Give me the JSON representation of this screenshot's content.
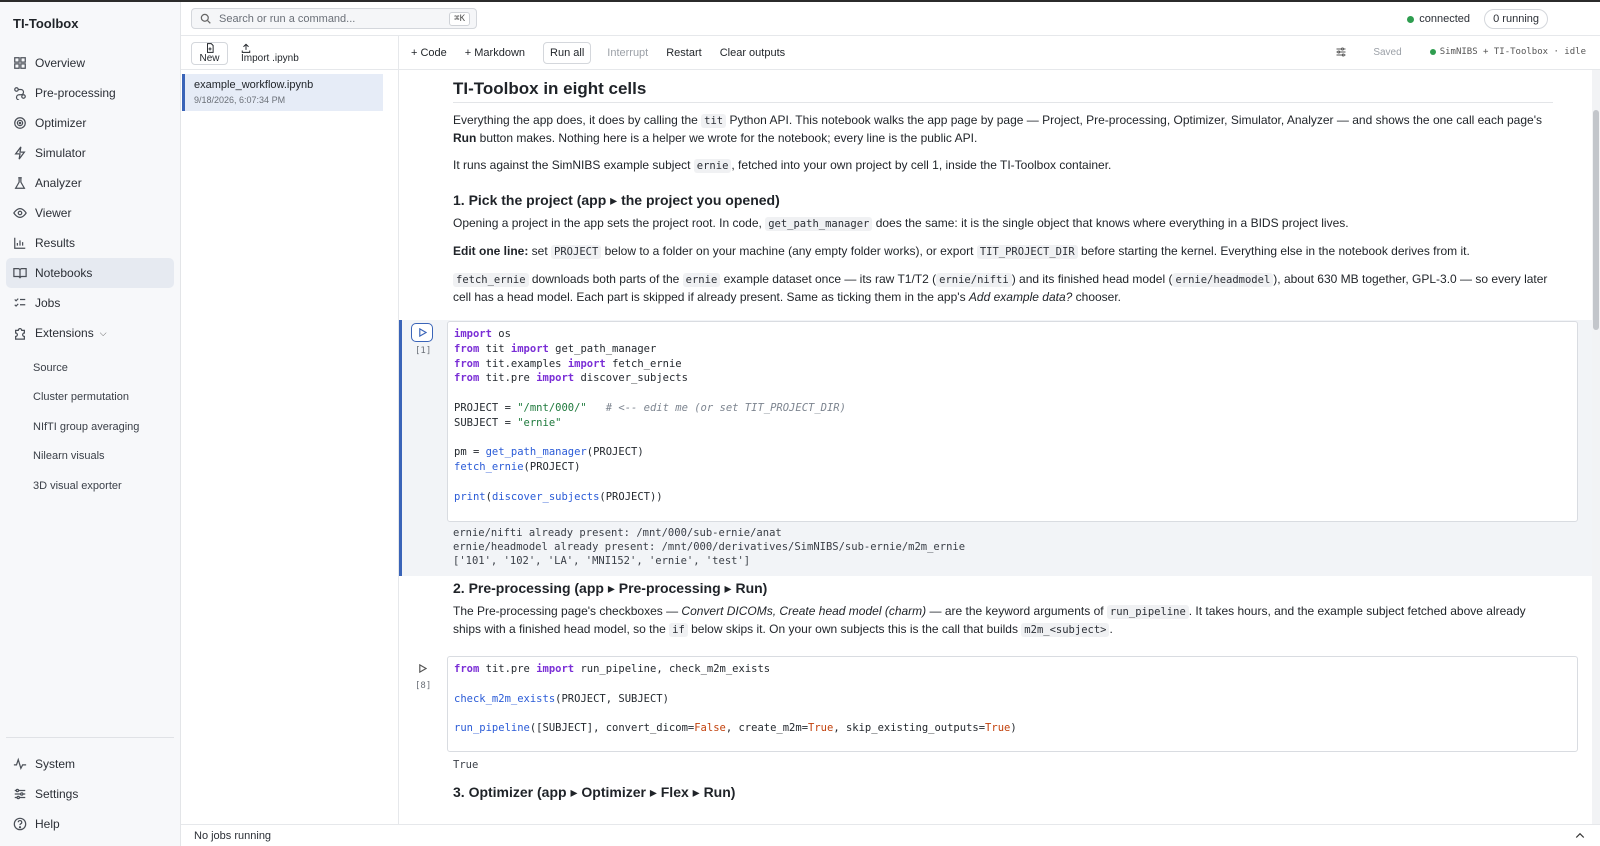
{
  "app": {
    "brand": "TI-Toolbox"
  },
  "sidebar": {
    "items": [
      {
        "label": "Overview",
        "icon": "grid-icon"
      },
      {
        "label": "Pre-processing",
        "icon": "flow-icon"
      },
      {
        "label": "Optimizer",
        "icon": "target-icon"
      },
      {
        "label": "Simulator",
        "icon": "bolt-icon"
      },
      {
        "label": "Analyzer",
        "icon": "flask-icon"
      },
      {
        "label": "Viewer",
        "icon": "eye-icon"
      },
      {
        "label": "Results",
        "icon": "chart-icon"
      },
      {
        "label": "Notebooks",
        "icon": "book-icon",
        "active": true
      },
      {
        "label": "Jobs",
        "icon": "checklist-icon"
      },
      {
        "label": "Extensions",
        "icon": "puzzle-icon"
      }
    ],
    "extensions": [
      "Source",
      "Cluster permutation",
      "NIfTI group averaging",
      "Nilearn visuals",
      "3D visual exporter"
    ],
    "bottom": [
      {
        "label": "System",
        "icon": "pulse-icon"
      },
      {
        "label": "Settings",
        "icon": "sliders-icon"
      },
      {
        "label": "Help",
        "icon": "help-icon"
      }
    ]
  },
  "topbar": {
    "search_placeholder": "Search or run a command...",
    "shortcut": "⌘K",
    "connection": "connected",
    "running": "0 running"
  },
  "files": {
    "new_label": "New",
    "import_label": "Import .ipynb",
    "items": [
      {
        "name": "example_workflow.ipynb",
        "date": "9/18/2026, 6:07:34 PM"
      }
    ]
  },
  "toolbar": {
    "add_code": "+ Code",
    "add_markdown": "+ Markdown",
    "run_all": "Run all",
    "interrupt": "Interrupt",
    "restart": "Restart",
    "clear_outputs": "Clear outputs",
    "saved": "Saved",
    "kernel": "SimNIBS + TI-Toolbox · idle"
  },
  "notebook": {
    "title": "TI-Toolbox in eight cells",
    "intro": {
      "p1_a": "Everything the app does, it does by calling the ",
      "p1_code": "tit",
      "p1_b": " Python API. This notebook walks the app page by page — Project, Pre-processing, Optimizer, Simulator, Analyzer — and shows the one call each page's ",
      "p1_bold": "Run",
      "p1_c": " button makes. Nothing here is a helper we wrote for the notebook; every line is the public API.",
      "p2_a": "It runs against the SimNIBS example subject ",
      "p2_code": "ernie",
      "p2_b": ", fetched into your own project by cell 1, inside the TI-Toolbox container."
    },
    "section1": {
      "heading": "1. Pick the project (app ▸ the project you opened)",
      "p1_a": "Opening a project in the app sets the project root. In code, ",
      "p1_code": "get_path_manager",
      "p1_b": " does the same: it is the single object that knows where everything in a BIDS project lives.",
      "p2_bold": "Edit one line:",
      "p2_a": " set ",
      "p2_code1": "PROJECT",
      "p2_b": " below to a folder on your machine (any empty folder works), or export ",
      "p2_code2": "TIT_PROJECT_DIR",
      "p2_c": " before starting the kernel. Everything else in the notebook derives from it.",
      "p3_code1": "fetch_ernie",
      "p3_a": " downloads both parts of the ",
      "p3_code2": "ernie",
      "p3_b": " example dataset once — its raw T1/T2 (",
      "p3_code3": "ernie/nifti",
      "p3_c": ") and its finished head model (",
      "p3_code4": "ernie/headmodel",
      "p3_d": "), about 630 MB together, GPL-3.0 — so every later cell has a head model. Each part is skipped if already present. Same as ticking them in the app's ",
      "p3_em": "Add example data?",
      "p3_e": " chooser."
    },
    "cell1": {
      "count": "[1]",
      "output": [
        "ernie/nifti already present: /mnt/000/sub-ernie/anat",
        "ernie/headmodel already present: /mnt/000/derivatives/SimNIBS/sub-ernie/m2m_ernie",
        "['101', '102', 'LA', 'MNI152', 'ernie', 'test']"
      ]
    },
    "section2": {
      "heading": "2. Pre-processing (app ▸ Pre-processing ▸ Run)",
      "p_a": "The Pre-processing page's checkboxes — ",
      "p_em": "Convert DICOMs, Create head model (charm)",
      "p_b": " — are the keyword arguments of ",
      "p_code1": "run_pipeline",
      "p_c": ". It takes hours, and the example subject fetched above already ships with a finished head model, so the ",
      "p_code2": "if",
      "p_d": " below skips it. On your own subjects this is the call that builds ",
      "p_code3": "m2m_<subject>",
      "p_e": "."
    },
    "cell2": {
      "count": "[8]",
      "output": "True"
    },
    "section3": {
      "heading": "3. Optimizer (app ▸ Optimizer ▸ Flex ▸ Run)"
    }
  },
  "status": {
    "jobs": "No jobs running"
  },
  "colors": {
    "accent": "#3a64b8",
    "connected": "#2e9d4f"
  }
}
